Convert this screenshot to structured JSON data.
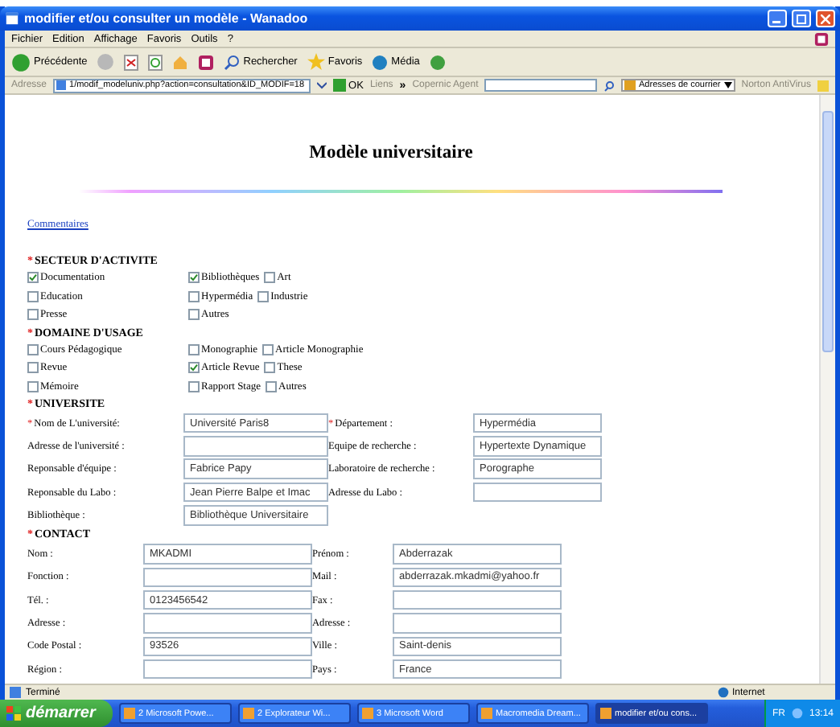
{
  "window": {
    "title": "modifier et/ou consulter un modèle - Wanadoo"
  },
  "menu": [
    "Fichier",
    "Edition",
    "Affichage",
    "Favoris",
    "Outils",
    "?"
  ],
  "toolbar": {
    "back": "Précédente",
    "search": "Rechercher",
    "favorites": "Favoris",
    "media": "Média"
  },
  "address_bar": {
    "label": "Adresse",
    "url": "1/modif_modeluniv.php?action=consultation&ID_MODIF=18",
    "go": "OK",
    "links": "Liens",
    "chevron": "»",
    "agent": "Copernic Agent",
    "mail": "Adresses de courrier",
    "antivirus": "Norton AntiVirus"
  },
  "page": {
    "title": "Modèle universitaire",
    "link": "Commentaires",
    "sections": [
      {
        "kind": "checkboxes",
        "mark": "*",
        "heading": "SECTEUR D'ACTIVITE",
        "rows": [
          {
            "cells": [
              [
                {
                  "label": "Documentation",
                  "checked": true
                }
              ],
              [
                {
                  "label": "Bibliothèques",
                  "checked": true
                },
                {
                  "label": "Art",
                  "checked": false
                }
              ]
            ]
          },
          {
            "cells": [
              [
                {
                  "label": "Education",
                  "checked": false
                }
              ],
              [
                {
                  "label": "Hypermédia",
                  "checked": false
                },
                {
                  "label": "Industrie",
                  "checked": false
                }
              ]
            ]
          },
          {
            "cells": [
              [
                {
                  "label": "Presse",
                  "checked": false
                }
              ],
              [
                {
                  "label": "Autres",
                  "checked": false
                }
              ]
            ]
          }
        ]
      },
      {
        "kind": "checkboxes",
        "mark": "*",
        "heading": "DOMAINE D'USAGE",
        "rows": [
          {
            "cells": [
              [
                {
                  "label": "Cours Pédagogique",
                  "checked": false
                }
              ],
              [
                {
                  "label": "Monographie",
                  "checked": false
                },
                {
                  "label": "Article Monographie",
                  "checked": false
                }
              ]
            ]
          },
          {
            "cells": [
              [
                {
                  "label": "Revue",
                  "checked": false
                }
              ],
              [
                {
                  "label": "Article Revue",
                  "checked": true
                },
                {
                  "label": "These",
                  "checked": false
                }
              ]
            ]
          },
          {
            "cells": [
              [
                {
                  "label": "Mémoire",
                  "checked": false
                }
              ],
              [
                {
                  "label": "Rapport Stage",
                  "checked": false
                },
                {
                  "label": "Autres",
                  "checked": false
                }
              ]
            ]
          }
        ]
      },
      {
        "kind": "fields",
        "mark": "*",
        "heading": "UNIVERSITE",
        "rows": [
          [
            {
              "mark": "*",
              "label": "Nom de L'université:",
              "value": "Université Paris8"
            },
            {
              "mark": "*",
              "label": "Département :",
              "value": "Hypermédia"
            }
          ],
          [
            {
              "label": "Adresse de l'université :"
            },
            {
              "label": "Equipe de recherche :",
              "value": "Hypertexte Dynamique"
            }
          ],
          [
            {
              "label": "Reponsable d'équipe :",
              "value": "Fabrice Papy"
            },
            {
              "label": "Laboratoire de recherche :",
              "value": "Porographe"
            }
          ],
          [
            {
              "label": "Reponsable du Labo :",
              "value": "Jean Pierre Balpe et Imac"
            },
            {
              "label": "Adresse du Labo :"
            }
          ],
          [
            {
              "label": "Bibliothèque :",
              "value": "Bibliothèque Universitaire"
            }
          ]
        ]
      },
      {
        "kind": "contacts",
        "mark": "*",
        "heading": "CONTACT",
        "rows": [
          [
            {
              "label": "Nom :",
              "value": "MKADMI"
            },
            {
              "label": "Prénom :",
              "value": "Abderrazak"
            }
          ],
          [
            {
              "label": "Fonction :"
            },
            {
              "label": "Mail :",
              "value": "abderrazak.mkadmi@yahoo.fr"
            }
          ],
          [
            {
              "label": "Tél. :",
              "value": "0123456542"
            },
            {
              "label": "Fax :"
            }
          ],
          [
            {
              "label": "Adresse :"
            },
            {
              "label": "Adresse :"
            }
          ],
          [
            {
              "label": "Code Postal :",
              "value": "93526"
            },
            {
              "label": "Ville :",
              "value": "Saint-denis"
            }
          ],
          [
            {
              "label": "Région :"
            },
            {
              "label": "Pays :",
              "value": "France"
            }
          ]
        ]
      }
    ]
  },
  "status_bar": {
    "text": "Terminé",
    "zone": "Internet"
  },
  "taskbar": {
    "start": "démarrer",
    "tasks": [
      {
        "label": "2 Microsoft Powe...",
        "selected": false
      },
      {
        "label": "2 Explorateur Wi...",
        "selected": false
      },
      {
        "label": "3 Microsoft Word",
        "selected": false
      },
      {
        "label": "Macromedia Dream...",
        "selected": false
      },
      {
        "label": "modifier et/ou cons...",
        "selected": true
      }
    ],
    "language": "FR",
    "clock": "13:14"
  }
}
